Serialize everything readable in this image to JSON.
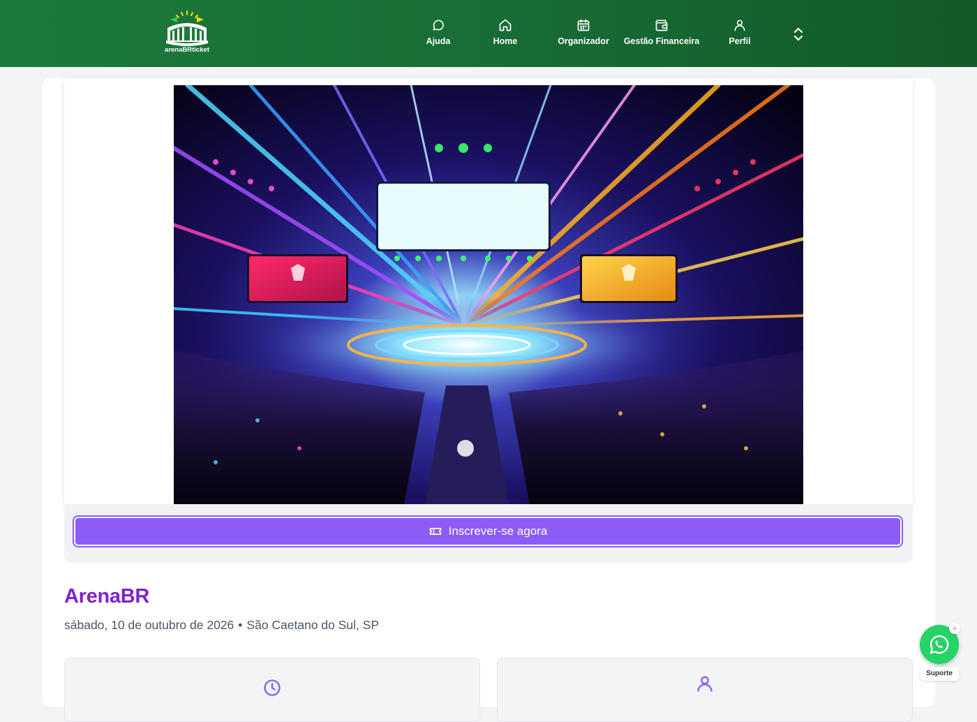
{
  "header": {
    "logo_text": "arenaBRticket",
    "nav": [
      {
        "label": "Ajuda",
        "icon": "chat-bubble-icon"
      },
      {
        "label": "Home",
        "icon": "home-icon"
      },
      {
        "label": "Organizador",
        "icon": "calendar-icon"
      },
      {
        "label": "Gestão Financeira",
        "icon": "wallet-icon"
      },
      {
        "label": "Perfil",
        "icon": "user-icon"
      }
    ],
    "expand_icon": "chevron-up-down-icon"
  },
  "event": {
    "banner": "arena-stage-concert-image",
    "cta_label": "Inscrever-se agora",
    "cta_icon": "ticket-icon",
    "title": "ArenaBR",
    "date": "sábado, 10 de outubro de 2026",
    "separator": "•",
    "location": "São Caetano do Sul, SP",
    "info_icons": [
      "clock-icon",
      "user-icon"
    ]
  },
  "support": {
    "label": "Suporte",
    "icon": "whatsapp-icon",
    "badge": "+"
  },
  "colors": {
    "header_green": "#1b7a3c",
    "accent_purple": "#8b5cf6",
    "title_purple": "#7e22ce",
    "whatsapp_green": "#25d366"
  }
}
